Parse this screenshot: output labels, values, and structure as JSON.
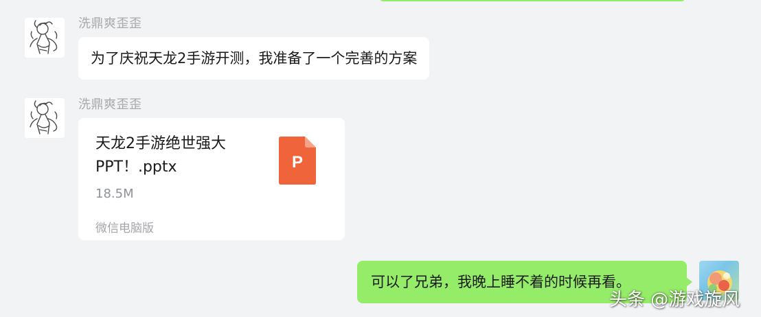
{
  "messages": [
    {
      "sender": "洗鼎爽歪歪",
      "text": "为了庆祝天龙2手游开测，我准备了一个完善的方案"
    },
    {
      "sender": "洗鼎爽歪歪",
      "file": {
        "name": "天龙2手游绝世强大PPT！.pptx",
        "size": "18.5M",
        "source": "微信电脑版",
        "icon_letter": "P",
        "icon": "powerpoint-file-icon",
        "icon_color": "#f0643c"
      }
    },
    {
      "self": true,
      "text": "可以了兄弟，我晚上睡不着的时候再看。"
    }
  ],
  "watermark": "头条 @游戏旋风",
  "colors": {
    "background": "#f2f3f5",
    "incoming_bubble": "#ffffff",
    "outgoing_bubble": "#95ec69",
    "name_text": "#a7a9ad"
  }
}
